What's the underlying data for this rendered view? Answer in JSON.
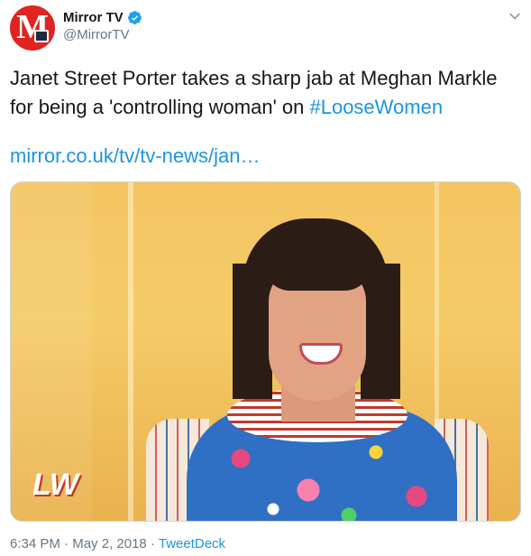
{
  "account": {
    "display_name": "Mirror TV",
    "handle": "@MirrorTV",
    "verified": true,
    "avatar_icon": "mirror-logo-icon"
  },
  "tweet": {
    "text_before": "Janet Street Porter takes a sharp jab at Meghan Markle for being a 'controlling woman' on ",
    "hashtag": "#LooseWomen",
    "link": "mirror.co.uk/tv/tv-news/jan…"
  },
  "media": {
    "logo_text": "LW"
  },
  "footer": {
    "time": "6:34 PM",
    "separator": "·",
    "date": "May 2, 2018",
    "source": "TweetDeck"
  },
  "colors": {
    "link": "#1b95e0",
    "meta": "#657786",
    "verified": "#1da1f2",
    "avatar_bg": "#e0241f"
  },
  "icons": {
    "verified": "verified-badge-icon",
    "caret": "chevron-down-icon"
  }
}
